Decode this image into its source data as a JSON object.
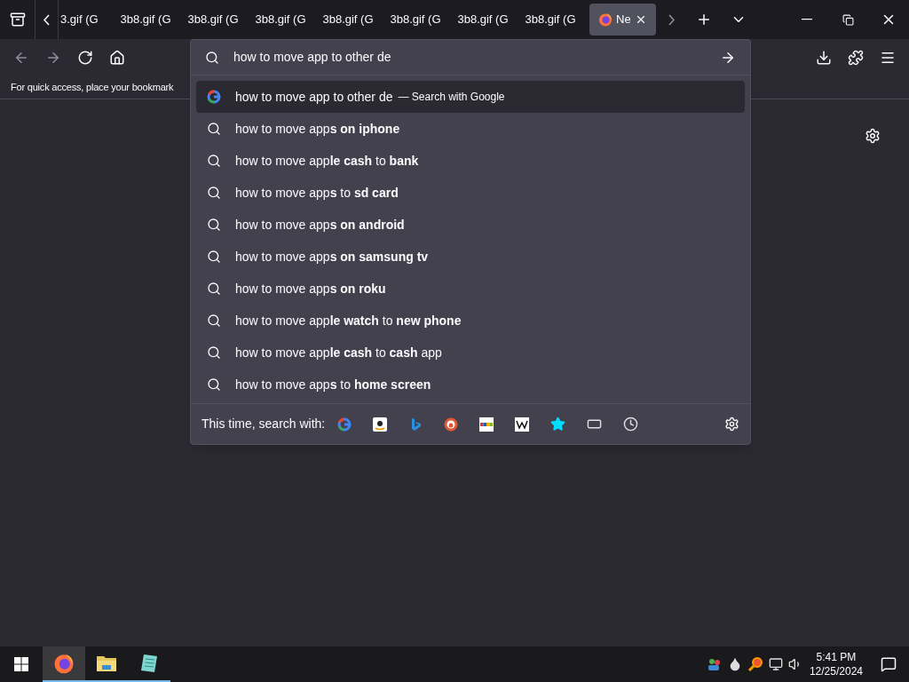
{
  "tabs": [
    {
      "label": "3.gif (G",
      "selected": false
    },
    {
      "label": "3b8.gif (G",
      "selected": false
    },
    {
      "label": "3b8.gif (G",
      "selected": false
    },
    {
      "label": "3b8.gif (G",
      "selected": false
    },
    {
      "label": "3b8.gif (G",
      "selected": false
    },
    {
      "label": "3b8.gif (G",
      "selected": false
    },
    {
      "label": "3b8.gif (G",
      "selected": false
    },
    {
      "label": "3b8.gif (G",
      "selected": false
    },
    {
      "label": "Ne",
      "selected": true
    }
  ],
  "bookmarks_bar": {
    "text": "For quick access, place your bookmark"
  },
  "address_bar": {
    "value": "how to move app to other de"
  },
  "suggestions": [
    {
      "kind": "engine",
      "text": "how to move app to other de",
      "hint": "— Search with Google",
      "selected": true
    },
    {
      "kind": "search",
      "text": "how to move app**s on iphone**",
      "selected": false
    },
    {
      "kind": "search",
      "text": "how to move app**le cash** to **bank**",
      "selected": false
    },
    {
      "kind": "search",
      "text": "how to move app**s** to **sd card**",
      "selected": false
    },
    {
      "kind": "search",
      "text": "how to move app**s on android**",
      "selected": false
    },
    {
      "kind": "search",
      "text": "how to move app**s on samsung tv**",
      "selected": false
    },
    {
      "kind": "search",
      "text": "how to move app**s on roku**",
      "selected": false
    },
    {
      "kind": "search",
      "text": "how to move app**le watch** to **new phone**",
      "selected": false
    },
    {
      "kind": "search",
      "text": "how to move app**le cash** to **cash** app",
      "selected": false
    },
    {
      "kind": "search",
      "text": "how to move app**s** to **home screen**",
      "selected": false
    }
  ],
  "search_with": {
    "label": "This time, search with:",
    "engines": [
      {
        "kind": "google"
      },
      {
        "kind": "amazon"
      },
      {
        "kind": "bing"
      },
      {
        "kind": "duckduckgo"
      },
      {
        "kind": "ebay"
      },
      {
        "kind": "wikipedia"
      },
      {
        "kind": "bookmarks"
      },
      {
        "kind": "tabs"
      },
      {
        "kind": "history"
      }
    ]
  },
  "taskbar": {
    "apps": [
      {
        "kind": "firefox",
        "selected": true
      },
      {
        "kind": "explorer",
        "selected": false
      },
      {
        "kind": "notepad",
        "selected": false
      }
    ],
    "time": "5:41 PM",
    "date": "12/25/2024"
  }
}
